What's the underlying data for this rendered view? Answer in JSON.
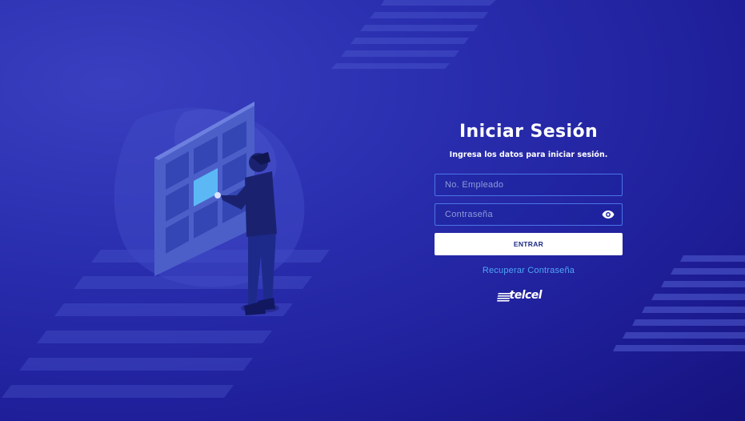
{
  "login": {
    "title": "Iniciar Sesión",
    "subtitle": "Ingresa los datos para iniciar sesión.",
    "employee_placeholder": "No. Empleado",
    "password_placeholder": "Contraseña",
    "submit_label": "ENTRAR",
    "recover_label": "Recuperar Contraseña"
  },
  "brand": {
    "name": "telcel"
  },
  "icons": {
    "password_toggle": "eye-icon"
  },
  "colors": {
    "background": "#2a2fb0",
    "link": "#4fa6f6",
    "button_text": "#1b2a86",
    "field_border": "#4c74e8"
  }
}
